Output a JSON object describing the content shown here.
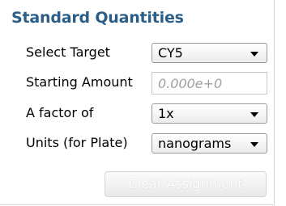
{
  "panel": {
    "title": "Standard Quantities"
  },
  "rows": {
    "target": {
      "label": "Select Target",
      "value": "CY5"
    },
    "amount": {
      "label": "Starting Amount",
      "placeholder": "0.000e+0",
      "value": ""
    },
    "factor": {
      "label": "A factor of",
      "value": "1x"
    },
    "units": {
      "label": "Units (for Plate)",
      "value": "nanograms"
    }
  },
  "buttons": {
    "clear_assignment": "Clear Assignment"
  },
  "colors": {
    "title": "#2a5d88",
    "disabled_button_text": "#ffffff"
  },
  "icons": {
    "dropdown": "chevron-down-icon"
  }
}
